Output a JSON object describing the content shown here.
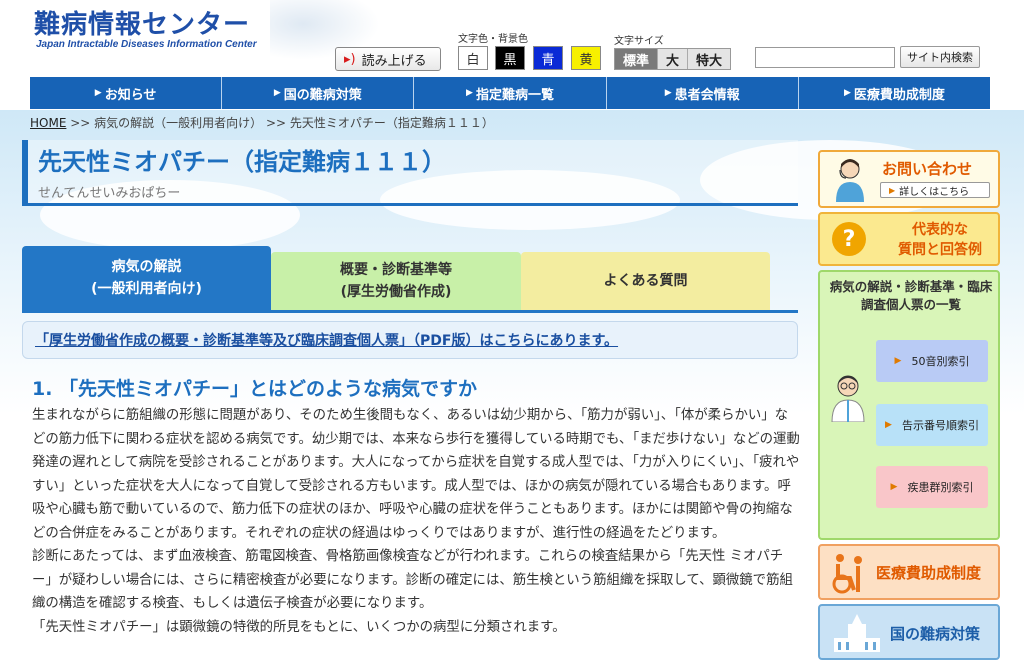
{
  "header": {
    "logo_title": "難病情報センター",
    "logo_subtitle": "Japan Intractable Diseases Information Center",
    "read_aloud": "読み上げる",
    "color_label": "文字色・背景色",
    "colors": [
      {
        "label": "白",
        "bg": "#ffffff",
        "fg": "#222222"
      },
      {
        "label": "黒",
        "bg": "#000000",
        "fg": "#ffffff"
      },
      {
        "label": "青",
        "bg": "#0a2ad6",
        "fg": "#ffffff"
      },
      {
        "label": "黄",
        "bg": "#f7f000",
        "fg": "#222222"
      }
    ],
    "size_label": "文字サイズ",
    "sizes": [
      "標準",
      "大",
      "特大"
    ],
    "search_value": "",
    "search_button": "サイト内検索"
  },
  "nav": [
    "お知らせ",
    "国の難病対策",
    "指定難病一覧",
    "患者会情報",
    "医療費助成制度"
  ],
  "breadcrumb": {
    "home": "HOME",
    "rest": ">> 病気の解説（一般利用者向け） >> 先天性ミオパチー（指定難病１１１）"
  },
  "page": {
    "title": "先天性ミオパチー（指定難病１１１）",
    "reading": "せんてんせいみおぱちー"
  },
  "tabs": [
    {
      "line1": "病気の解説",
      "line2": "(一般利用者向け)"
    },
    {
      "line1": "概要・診断基準等",
      "line2": "(厚生労働省作成)"
    },
    {
      "line1": "よくある質問",
      "line2": ""
    }
  ],
  "pdf_link": "「厚生労働省作成の概要・診断基準等及び臨床調査個人票」（PDF版）はこちらにあります。",
  "section": {
    "heading": "1. 「先天性ミオパチー」とはどのような病気ですか",
    "paragraphs": [
      "生まれながらに筋組織の形態に問題があり、そのため生後間もなく、あるいは幼少期から、「筋力が弱い」、「体が柔らかい」などの筋力低下に関わる症状を認める病気です。幼少期では、本来なら歩行を獲得している時期でも、「まだ歩けない」などの運動発達の遅れとして病院を受診されることがあります。大人になってから症状を自覚する成人型では、「力が入りにくい」、「疲れやすい」といった症状を大人になって自覚して受診される方もいます。成人型では、ほかの病気が隠れている場合もあります。呼吸や心臓も筋で動いているので、筋力低下の症状のほか、呼吸や心臓の症状を伴うこともあります。ほかには関節や骨の拘縮などの合併症をみることがあります。それぞれの症状の経過はゆっくりではありますが、進行性の経過をたどります。",
      "診断にあたっては、まず血液検査、筋電図検査、骨格筋画像検査などが行われます。これらの検査結果から「先天性 ミオパチー」が疑わしい場合には、さらに精密検査が必要になります。診断の確定には、筋生検という筋組織を採取して、顕微鏡で筋組織の構造を確認する検査、もしくは遺伝子検査が必要になります。",
      "「先天性ミオパチー」は顕微鏡の特徴的所見をもとに、いくつかの病型に分類されます。"
    ]
  },
  "sidebar": {
    "contact_title": "お問い合わせ",
    "contact_button": "詳しくはこちら",
    "faq_line1": "代表的な",
    "faq_line2": "質問と回答例",
    "faq_mark": "?",
    "list_title": "病気の解説・診断基準・臨床調査個人票の一覧",
    "index_buttons": [
      "50音別索引",
      "告示番号順索引",
      "疾患群別索引"
    ],
    "subsidy": "医療費助成制度",
    "policy": "国の難病対策"
  }
}
